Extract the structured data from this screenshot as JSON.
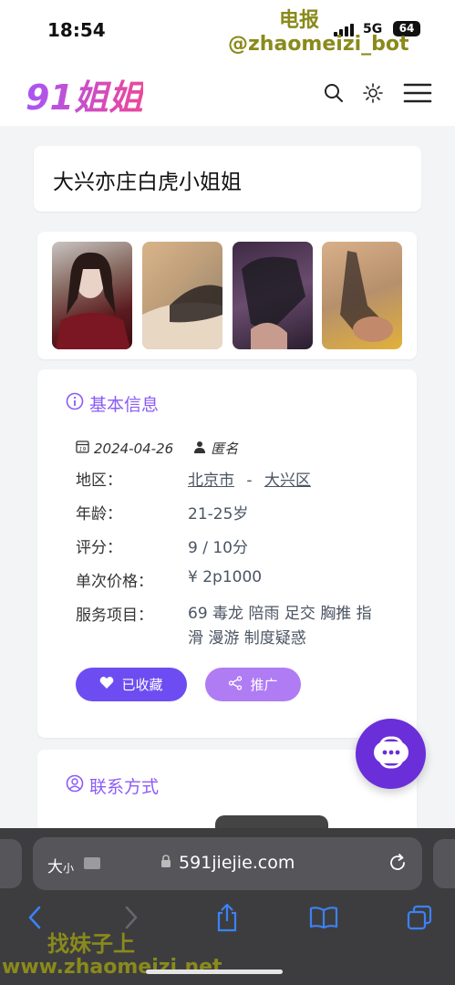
{
  "status_bar": {
    "time": "18:54",
    "network": "5G",
    "battery": "64"
  },
  "watermark": {
    "top_line1": "电报",
    "top_line2": "@zhaomeizi_bot",
    "bottom_line1": "找妹子上",
    "bottom_line2": "www.zhaomeizi.net"
  },
  "header": {
    "logo": "91姐姐",
    "icons": [
      "search-icon",
      "theme-toggle-icon",
      "menu-icon"
    ]
  },
  "post": {
    "title": "大兴亦庄白虎小姐姐"
  },
  "photos": {
    "count": 4
  },
  "info": {
    "section_title": "基本信息",
    "date": "2024-04-26",
    "author": "匿名",
    "fields": [
      {
        "label": "地区：",
        "value": ""
      },
      {
        "label": "年龄：",
        "value": "21-25岁"
      },
      {
        "label": "评分：",
        "value": "9 / 10分"
      },
      {
        "label": "单次价格：",
        "value": "¥ 2p1000"
      },
      {
        "label": "服务项目：",
        "value": "69 毒龙 陪雨 足交 胸推 指滑 漫游 制度疑惑"
      }
    ],
    "region_city": "北京市",
    "region_sep": "-",
    "region_district": "大兴区",
    "favorite_label": "已收藏",
    "share_label": "推广"
  },
  "contact": {
    "section_title": "联系方式"
  },
  "safari": {
    "text_size": "大",
    "text_size_small": "小",
    "url": "591jiejie.com"
  },
  "colors": {
    "accent": "#8b5cf6",
    "favorite_btn": "#6d4df2",
    "share_btn": "#b07cf4",
    "fab": "#6a2fd8"
  }
}
